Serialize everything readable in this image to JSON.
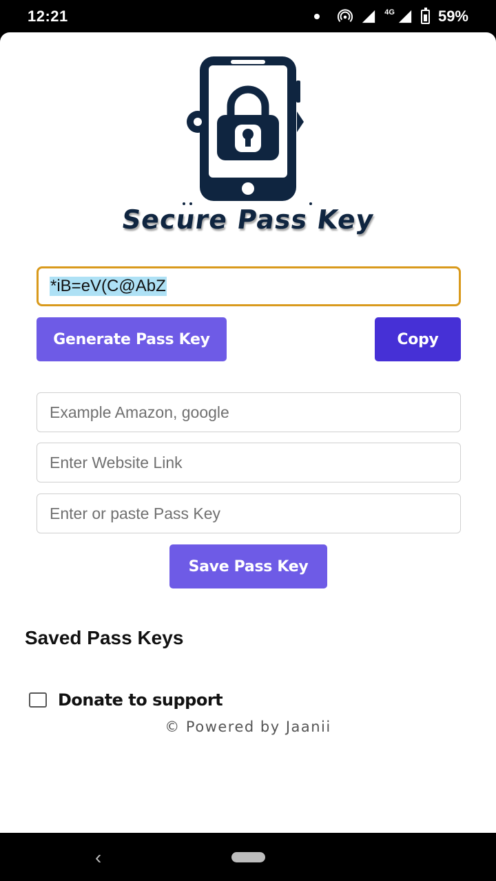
{
  "status_bar": {
    "time": "12:21",
    "network": "4G",
    "battery": "59%"
  },
  "app": {
    "brand": "Secure Pass Key",
    "generated_key": "*iB=eV(C@AbZ",
    "generate_label": "Generate Pass Key",
    "copy_label": "Copy",
    "fields": {
      "name_placeholder": "Example Amazon, google",
      "link_placeholder": "Enter Website Link",
      "key_placeholder": "Enter or paste Pass Key"
    },
    "save_label": "Save Pass Key",
    "saved_heading": "Saved Pass Keys",
    "donate_label": "Donate to support",
    "powered_by": "© Powered by Jaanii"
  },
  "nav": {
    "back_icon": "‹"
  },
  "colors": {
    "accent": "#6e5be6",
    "copy": "#4630d6",
    "focus_border": "#d99a1c",
    "brand_dark": "#0f2540"
  }
}
